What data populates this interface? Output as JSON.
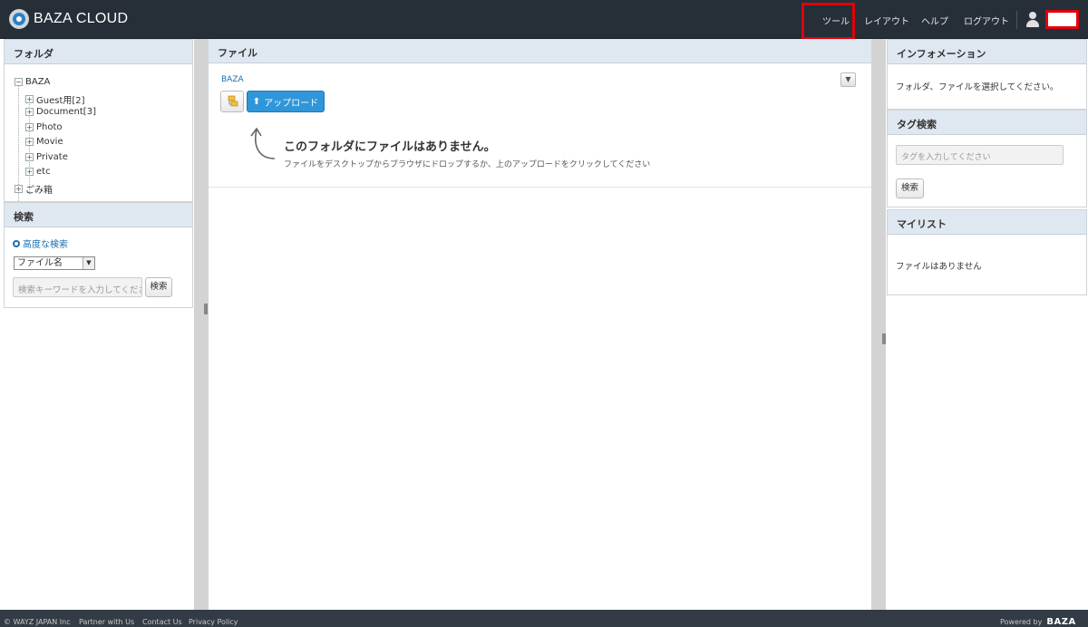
{
  "header": {
    "app_name": "BAZA CLOUD",
    "nav": {
      "tools": "ツール",
      "layout": "レイアウト",
      "help": "ヘルプ",
      "logout": "ログアウト"
    },
    "highlight_color": "#e0000c"
  },
  "folders": {
    "title": "フォルダ",
    "root": "BAZA",
    "items": [
      "Guest用[2]",
      "Document[3]",
      "Photo",
      "Movie",
      "Private",
      "etc"
    ],
    "trash": "ごみ箱"
  },
  "search": {
    "title": "検索",
    "advanced_link": "高度な検索",
    "field_select": "ファイル名",
    "keyword_placeholder": "検索キーワードを入力してください",
    "button": "検索"
  },
  "files": {
    "title": "ファイル",
    "breadcrumb": "BAZA",
    "upload_button": "アップロード",
    "empty_title": "このフォルダにファイルはありません。",
    "empty_hint": "ファイルをデスクトップからブラウザにドロップするか、上のアップロードをクリックしてください"
  },
  "info": {
    "title": "インフォメーション",
    "text": "フォルダ、ファイルを選択してください。"
  },
  "tag_search": {
    "title": "タグ検索",
    "placeholder": "タグを入力してください",
    "button": "検索"
  },
  "mylist": {
    "title": "マイリスト",
    "empty": "ファイルはありません"
  },
  "footer": {
    "copyright": "© WAYZ JAPAN Inc",
    "links": [
      "Partner with Us",
      "Contact Us",
      "Privacy Policy"
    ],
    "powered_by": "Powered by",
    "brand": "BAZA"
  },
  "colors": {
    "header_bg": "#262f38",
    "accent_blue": "#2f96d9",
    "panel_head": "#dfe8f0"
  }
}
